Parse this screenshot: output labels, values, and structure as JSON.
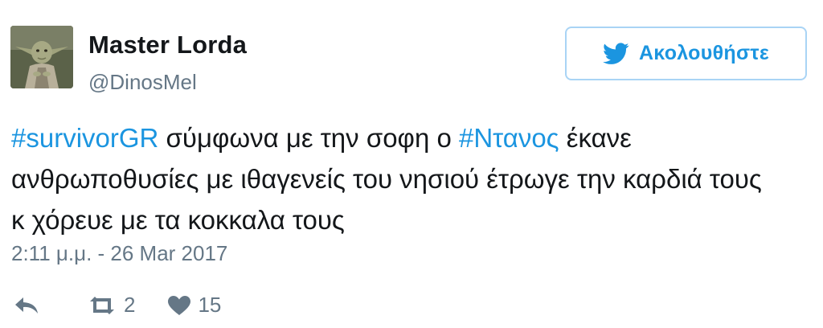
{
  "user": {
    "name": "Master Lorda",
    "handle": "@DinosMel"
  },
  "follow": {
    "label": "Ακολουθήστε"
  },
  "tweet": {
    "hashtag1": "#survivorGR",
    "text1": " σύμφωνα με την σοφη ο ",
    "hashtag2": "#Ντανος",
    "text2": " έκανε",
    "line2": "ανθρωποθυσίες με ιθαγενείς του νησιού έτρωγε την καρδιά τους",
    "line3": "κ χόρευε με τα κοκκαλα τους"
  },
  "timestamp": "2:11 μ.μ. - 26 Mar 2017",
  "actions": {
    "retweets": "2",
    "likes": "15"
  },
  "colors": {
    "link": "#1b95e0",
    "secondary_text": "#657786",
    "button_border": "#a9d4f5"
  },
  "icons": {
    "avatar": "yoda-avatar",
    "bird": "twitter-bird-icon",
    "reply": "reply-icon",
    "retweet": "retweet-icon",
    "like": "heart-icon"
  }
}
